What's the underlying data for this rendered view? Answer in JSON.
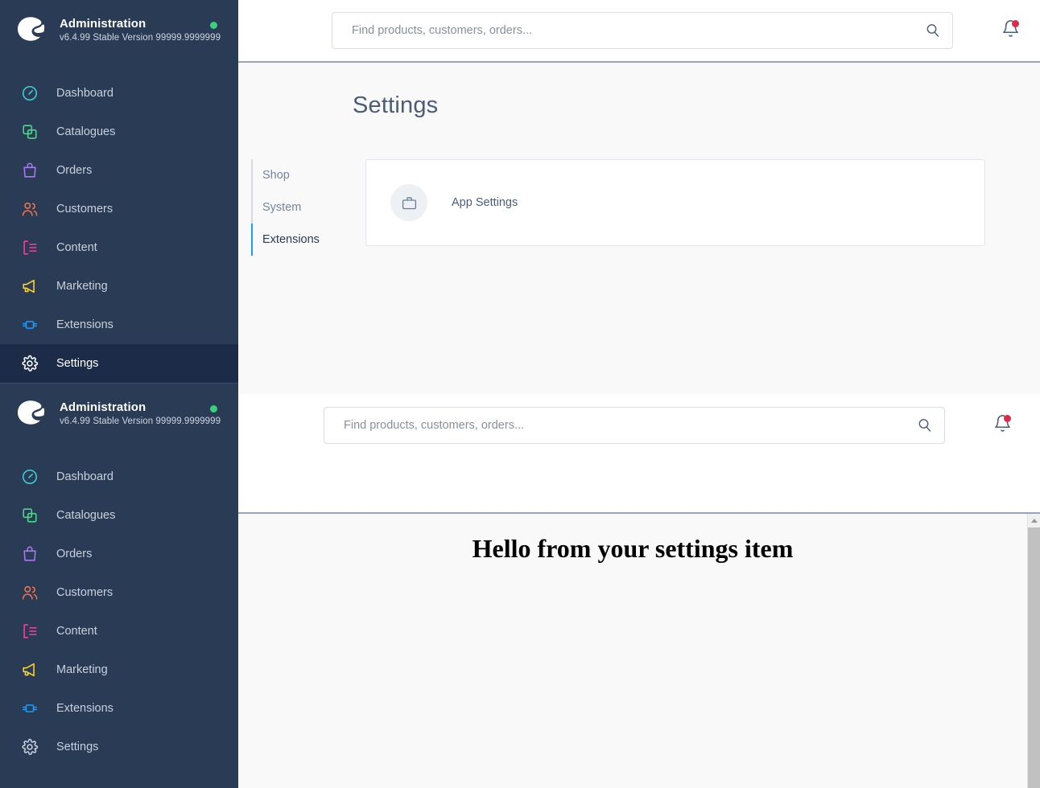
{
  "colors": {
    "sidebar_bg": "#2a3b55",
    "sidebar_active_bg": "#1c2c48",
    "accent_blue": "#189eff",
    "status_green": "#37d279",
    "badge_red": "#de294c",
    "content_bg": "#f9f9fa",
    "title_text": "#4a5c78"
  },
  "sidebar": {
    "logo_icon": "shopware-logo-icon",
    "app_title": "Administration",
    "version": "v6.4.99 Stable Version 99999.9999999",
    "status_dot": "online-status-dot",
    "items": [
      {
        "label": "Dashboard",
        "icon": "dashboard-icon",
        "color": "#3ecfd6",
        "active": false
      },
      {
        "label": "Catalogues",
        "icon": "catalogues-icon",
        "color": "#4ed88a",
        "active": false
      },
      {
        "label": "Orders",
        "icon": "orders-icon",
        "color": "#a978f0",
        "active": false
      },
      {
        "label": "Customers",
        "icon": "customers-icon",
        "color": "#f0734a",
        "active": false
      },
      {
        "label": "Content",
        "icon": "content-icon",
        "color": "#f3439b",
        "active": false
      },
      {
        "label": "Marketing",
        "icon": "marketing-icon",
        "color": "#ffd527",
        "active": false
      },
      {
        "label": "Extensions",
        "icon": "extensions-icon",
        "color": "#189eff",
        "active": false
      },
      {
        "label": "Settings",
        "icon": "settings-gear-icon",
        "color": "#ffffff",
        "active": true
      }
    ],
    "items_lower": [
      {
        "label": "Dashboard",
        "icon": "dashboard-icon",
        "color": "#3ecfd6",
        "active": false
      },
      {
        "label": "Catalogues",
        "icon": "catalogues-icon",
        "color": "#4ed88a",
        "active": false
      },
      {
        "label": "Orders",
        "icon": "orders-icon",
        "color": "#a978f0",
        "active": false
      },
      {
        "label": "Customers",
        "icon": "customers-icon",
        "color": "#f0734a",
        "active": false
      },
      {
        "label": "Content",
        "icon": "content-icon",
        "color": "#f3439b",
        "active": false
      },
      {
        "label": "Marketing",
        "icon": "marketing-icon",
        "color": "#ffd527",
        "active": false
      },
      {
        "label": "Extensions",
        "icon": "extensions-icon",
        "color": "#189eff",
        "active": false
      },
      {
        "label": "Settings",
        "icon": "settings-gear-icon",
        "color": "#c8d0dc",
        "active": false
      }
    ]
  },
  "topbar_primary": {
    "search_placeholder": "Find products, customers, orders...",
    "search_value": "",
    "search_icon": "search-icon",
    "notifications_icon": "bell-icon",
    "has_notification_badge": true
  },
  "topbar_secondary": {
    "search_placeholder": "Find products, customers, orders...",
    "search_value": "",
    "search_icon": "search-icon",
    "notifications_icon": "bell-icon",
    "has_notification_badge": true
  },
  "settings_page": {
    "title": "Settings",
    "tabs": [
      {
        "label": "Shop",
        "active": false
      },
      {
        "label": "System",
        "active": false
      },
      {
        "label": "Extensions",
        "active": true
      }
    ],
    "cards": [
      {
        "label": "App Settings",
        "icon": "briefcase-icon"
      }
    ]
  },
  "embedded_frame": {
    "heading": "Hello from your settings item"
  },
  "scrollbar": {
    "arrow_up_icon": "chevron-up-icon"
  }
}
